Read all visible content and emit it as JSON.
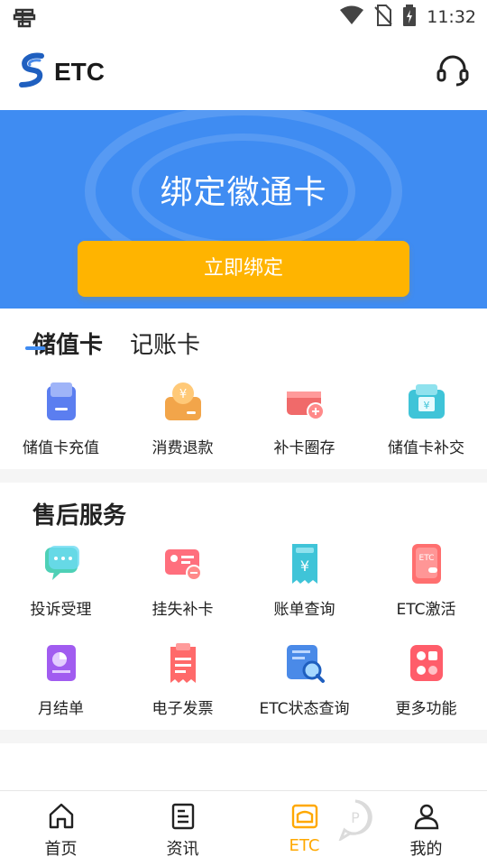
{
  "status_bar": {
    "time": "11:32",
    "left_icon": "bug-icon"
  },
  "header": {
    "title": "ETC",
    "logo": "etc-logo",
    "support_icon": "headset-icon"
  },
  "hero": {
    "title": "绑定徽通卡",
    "button_label": "立即绑定",
    "colors": {
      "blue": "#3f8cf2",
      "button": "#ffb400"
    }
  },
  "card_tabs": [
    {
      "label": "储值卡",
      "active": true
    },
    {
      "label": "记账卡",
      "active": false
    }
  ],
  "card_actions": [
    {
      "label": "储值卡充值",
      "icon": "card-topup-icon"
    },
    {
      "label": "消费退款",
      "icon": "refund-icon"
    },
    {
      "label": "补卡圈存",
      "icon": "card-load-icon"
    },
    {
      "label": "储值卡补交",
      "icon": "wallet-icon"
    }
  ],
  "service": {
    "title": "售后服务",
    "row1": [
      {
        "label": "投诉受理",
        "icon": "chat-icon"
      },
      {
        "label": "挂失补卡",
        "icon": "lost-card-icon"
      },
      {
        "label": "账单查询",
        "icon": "bill-icon"
      },
      {
        "label": "ETC激活",
        "icon": "etc-activate-icon"
      }
    ],
    "row2": [
      {
        "label": "月结单",
        "icon": "monthly-statement-icon"
      },
      {
        "label": "电子发票",
        "icon": "invoice-icon"
      },
      {
        "label": "ETC状态查询",
        "icon": "status-search-icon"
      },
      {
        "label": "更多功能",
        "icon": "more-icon"
      }
    ]
  },
  "bottom_nav": [
    {
      "label": "首页",
      "icon": "home-icon",
      "active": false
    },
    {
      "label": "资讯",
      "icon": "news-icon",
      "active": false
    },
    {
      "label": "ETC",
      "icon": "etc-nav-icon",
      "active": true
    },
    {
      "label": "我的",
      "icon": "profile-icon",
      "active": false
    }
  ]
}
